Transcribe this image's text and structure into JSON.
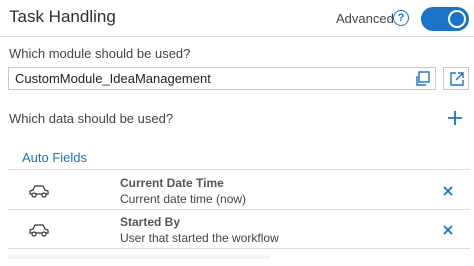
{
  "header": {
    "title": "Task Handling",
    "advanced_label": "Advanced",
    "help_glyph": "?",
    "advanced_enabled": true
  },
  "module": {
    "question": "Which module should be used?",
    "value": "CustomModule_IdeaManagement"
  },
  "data_section": {
    "question": "Which data should be used?"
  },
  "tabs": [
    {
      "label": "Auto Fields",
      "active": true
    }
  ],
  "fields": [
    {
      "title": "Current Date Time",
      "description": "Current date time (now)",
      "icon": "car-icon"
    },
    {
      "title": "Started By",
      "description": "User that started the workflow",
      "icon": "car-icon"
    }
  ],
  "colors": {
    "accent": "#1a73c8",
    "border": "#dcdcdc"
  }
}
